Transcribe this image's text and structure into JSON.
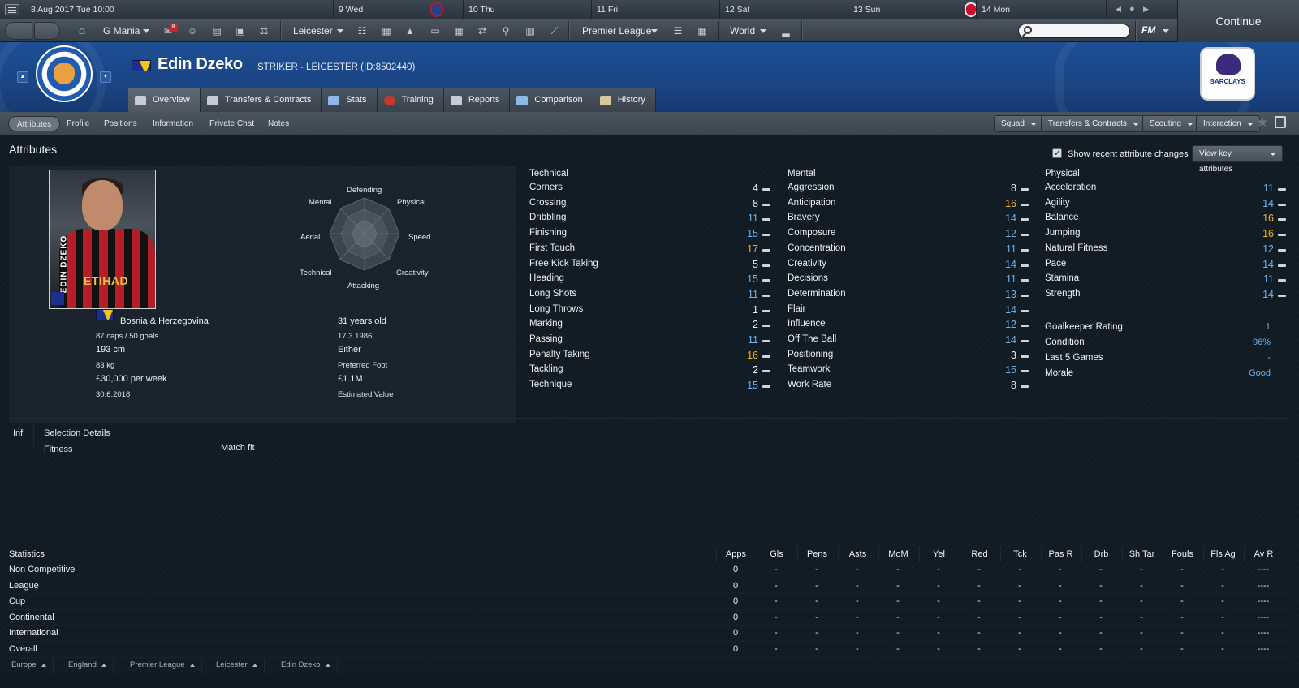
{
  "calendar": {
    "current": "8 Aug 2017  Tue  10:00",
    "days": [
      "9  Wed",
      "10  Thu",
      "11  Fri",
      "12  Sat",
      "13  Sun",
      "14  Mon"
    ]
  },
  "continue_label": "Continue",
  "toolbar": {
    "manager": "G Mania",
    "club": "Leicester",
    "competition": "Premier League",
    "world": "World",
    "inbox_count": "8",
    "search_placeholder": "",
    "fm_logo": "FM"
  },
  "player": {
    "name": "Edin Dzeko",
    "subtitle": "STRIKER - LEICESTER (ID:8502440)",
    "photo_side_name": "EDIN DZEKO",
    "shirt_sponsor": "ETIHAD"
  },
  "main_tabs": [
    "Overview",
    "Transfers & Contracts",
    "Stats",
    "Training",
    "Reports",
    "Comparison",
    "History"
  ],
  "sub_tabs": [
    "Attributes",
    "Profile",
    "Positions",
    "Information",
    "Private Chat",
    "Notes"
  ],
  "sub_dropdowns": [
    "Squad",
    "Transfers & Contracts",
    "Scouting",
    "Interaction"
  ],
  "section_title": "Attributes",
  "show_recent_label": "Show recent attribute changes",
  "key_attributes_btn": "View key attributes",
  "radar_labels": [
    "Defending",
    "Physical",
    "Speed",
    "Creativity",
    "Attacking",
    "Technical",
    "Aerial",
    "Mental"
  ],
  "info": {
    "nationality": "Bosnia & Herzegovina",
    "caps": "87 caps / 50 goals",
    "height": "193 cm",
    "weight": "83 kg",
    "wage": "£30,000 per week",
    "contract_end": "30.6.2018",
    "age": "31 years old",
    "dob": "17.3.1986",
    "foot": "Either",
    "foot_label": "Preferred Foot",
    "value": "£1.1M",
    "value_label": "Estimated Value"
  },
  "technical": {
    "title": "Technical",
    "items": [
      {
        "name": "Corners",
        "value": "4"
      },
      {
        "name": "Crossing",
        "value": "8"
      },
      {
        "name": "Dribbling",
        "value": "11"
      },
      {
        "name": "Finishing",
        "value": "15"
      },
      {
        "name": "First Touch",
        "value": "17"
      },
      {
        "name": "Free Kick Taking",
        "value": "5"
      },
      {
        "name": "Heading",
        "value": "15"
      },
      {
        "name": "Long Shots",
        "value": "11"
      },
      {
        "name": "Long Throws",
        "value": "1"
      },
      {
        "name": "Marking",
        "value": "2"
      },
      {
        "name": "Passing",
        "value": "11"
      },
      {
        "name": "Penalty Taking",
        "value": "16"
      },
      {
        "name": "Tackling",
        "value": "2"
      },
      {
        "name": "Technique",
        "value": "15"
      }
    ]
  },
  "mental": {
    "title": "Mental",
    "items": [
      {
        "name": "Aggression",
        "value": "8"
      },
      {
        "name": "Anticipation",
        "value": "16"
      },
      {
        "name": "Bravery",
        "value": "14"
      },
      {
        "name": "Composure",
        "value": "12"
      },
      {
        "name": "Concentration",
        "value": "11"
      },
      {
        "name": "Creativity",
        "value": "14"
      },
      {
        "name": "Decisions",
        "value": "11"
      },
      {
        "name": "Determination",
        "value": "13"
      },
      {
        "name": "Flair",
        "value": "14"
      },
      {
        "name": "Influence",
        "value": "12"
      },
      {
        "name": "Off The Ball",
        "value": "14"
      },
      {
        "name": "Positioning",
        "value": "3"
      },
      {
        "name": "Teamwork",
        "value": "15"
      },
      {
        "name": "Work Rate",
        "value": "8"
      }
    ]
  },
  "physical": {
    "title": "Physical",
    "items": [
      {
        "name": "Acceleration",
        "value": "11"
      },
      {
        "name": "Agility",
        "value": "14"
      },
      {
        "name": "Balance",
        "value": "16"
      },
      {
        "name": "Jumping",
        "value": "16"
      },
      {
        "name": "Natural Fitness",
        "value": "12"
      },
      {
        "name": "Pace",
        "value": "14"
      },
      {
        "name": "Stamina",
        "value": "11"
      },
      {
        "name": "Strength",
        "value": "14"
      }
    ],
    "extra": [
      {
        "name": "Goalkeeper Rating",
        "value": "1"
      },
      {
        "name": "Condition",
        "value": "96%"
      },
      {
        "name": "Last 5 Games",
        "value": "-"
      },
      {
        "name": "Morale",
        "value": "Good"
      }
    ]
  },
  "selection": {
    "inf": "Inf",
    "title": "Selection Details",
    "fitness_label": "Fitness",
    "fitness_value": "Match fit"
  },
  "statistics": {
    "title": "Statistics",
    "columns": [
      "Apps",
      "Gls",
      "Pens",
      "Asts",
      "MoM",
      "Yel",
      "Red",
      "Tck",
      "Pas R",
      "Drb",
      "Sh Tar",
      "Fouls",
      "Fls Ag",
      "Av R"
    ],
    "rows": [
      {
        "label": "Non Competitive",
        "cells": [
          "0",
          "-",
          "-",
          "-",
          "-",
          "-",
          "-",
          "-",
          "-",
          "-",
          "-",
          "-",
          "-",
          "----"
        ]
      },
      {
        "label": "League",
        "cells": [
          "0",
          "-",
          "-",
          "-",
          "-",
          "-",
          "-",
          "-",
          "-",
          "-",
          "-",
          "-",
          "-",
          "----"
        ]
      },
      {
        "label": "Cup",
        "cells": [
          "0",
          "-",
          "-",
          "-",
          "-",
          "-",
          "-",
          "-",
          "-",
          "-",
          "-",
          "-",
          "-",
          "----"
        ]
      },
      {
        "label": "Continental",
        "cells": [
          "0",
          "-",
          "-",
          "-",
          "-",
          "-",
          "-",
          "-",
          "-",
          "-",
          "-",
          "-",
          "-",
          "----"
        ]
      },
      {
        "label": "International",
        "cells": [
          "0",
          "-",
          "-",
          "-",
          "-",
          "-",
          "-",
          "-",
          "-",
          "-",
          "-",
          "-",
          "-",
          "----"
        ]
      },
      {
        "label": "Overall",
        "cells": [
          "0",
          "-",
          "-",
          "-",
          "-",
          "-",
          "-",
          "-",
          "-",
          "-",
          "-",
          "-",
          "-",
          "----"
        ]
      }
    ]
  },
  "breadcrumb": [
    "Europe",
    "England",
    "Premier League",
    "Leicester",
    "Edin Dzeko"
  ],
  "colors": {
    "high": "#f0b323",
    "mid": "#6eb3ec",
    "low": "#e9ecef",
    "header": "#1e4e95"
  }
}
